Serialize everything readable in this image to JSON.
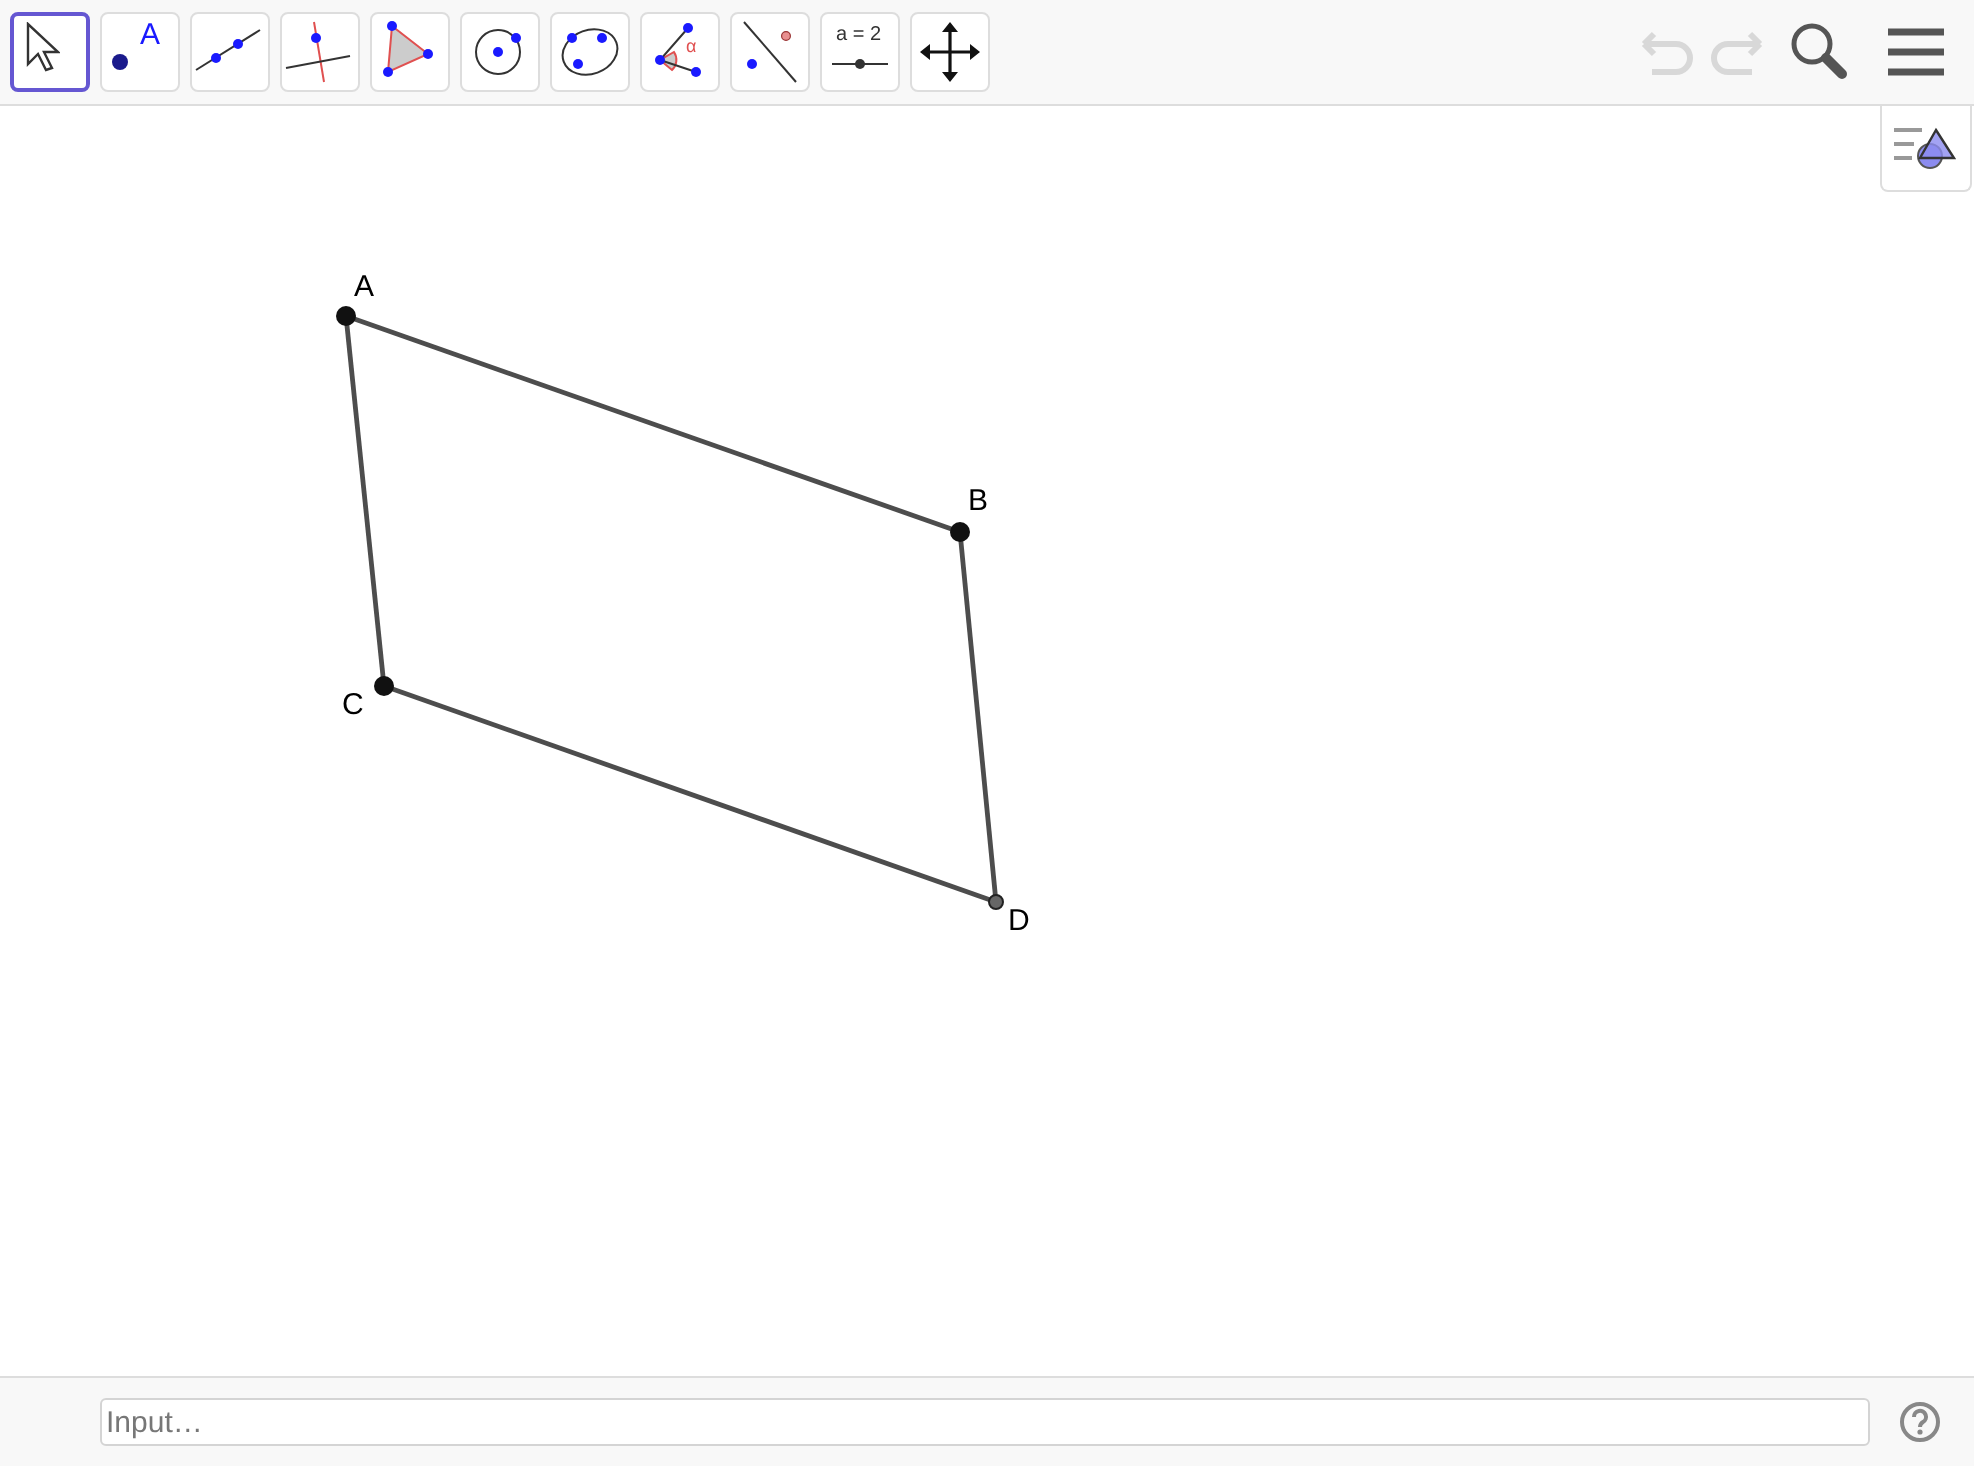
{
  "toolbar": {
    "tools": [
      {
        "kind": "move",
        "selected": true
      },
      {
        "kind": "point",
        "selected": false,
        "text": "A"
      },
      {
        "kind": "line",
        "selected": false
      },
      {
        "kind": "perpendicular",
        "selected": false
      },
      {
        "kind": "polygon",
        "selected": false
      },
      {
        "kind": "circle",
        "selected": false
      },
      {
        "kind": "conic",
        "selected": false
      },
      {
        "kind": "angle",
        "selected": false,
        "text": "α"
      },
      {
        "kind": "reflect",
        "selected": false
      },
      {
        "kind": "slider",
        "selected": false,
        "text": "a = 2"
      },
      {
        "kind": "pan",
        "selected": false
      }
    ],
    "undo": {
      "disabled": true
    },
    "redo": {
      "disabled": true
    }
  },
  "canvas": {
    "points": [
      {
        "label": "A",
        "kind": "free"
      },
      {
        "label": "B",
        "kind": "free"
      },
      {
        "label": "C",
        "kind": "free"
      },
      {
        "label": "D",
        "kind": "dependent"
      }
    ]
  },
  "input_bar": {
    "placeholder": "Input…"
  }
}
